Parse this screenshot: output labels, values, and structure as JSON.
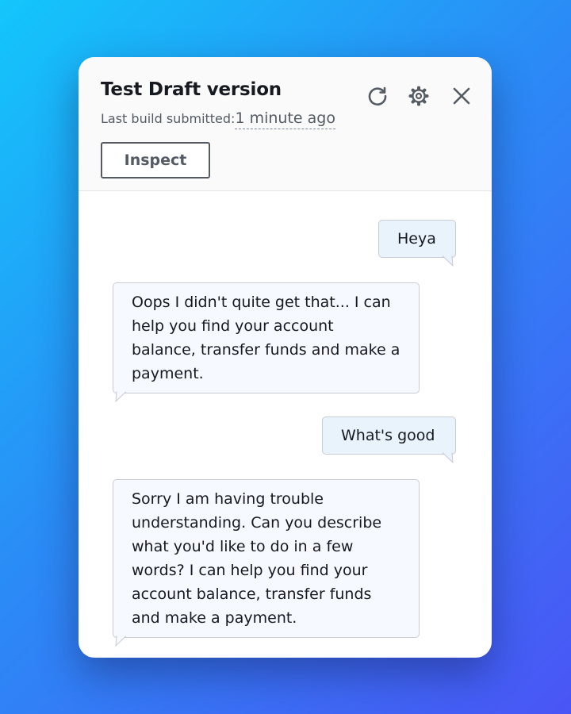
{
  "header": {
    "title": "Test Draft version",
    "subtitle_label": "Last build submitted:",
    "subtitle_time": "1 minute ago",
    "inspect_label": "Inspect",
    "icons": [
      "refresh-icon",
      "settings-icon",
      "close-icon"
    ]
  },
  "conversation": [
    {
      "role": "user",
      "text": "Heya"
    },
    {
      "role": "bot",
      "text": "Oops I didn't quite get that... I can help you find your account balance, transfer funds and make a payment."
    },
    {
      "role": "user",
      "text": "What's good"
    },
    {
      "role": "bot",
      "text": "Sorry I am having trouble understanding. Can you describe what you'd like to do in a few words? I can help you find your account balance, transfer funds and make a payment."
    }
  ],
  "colors": {
    "background_gradient": [
      "#13c6fb",
      "#2a8cf6",
      "#4a55f5"
    ],
    "panel": "#ffffff",
    "header": "#fafafa",
    "user_bubble": "#e8f3fc",
    "bot_bubble": "#f6f9ff",
    "text": "#16191f",
    "muted": "#545b64"
  }
}
